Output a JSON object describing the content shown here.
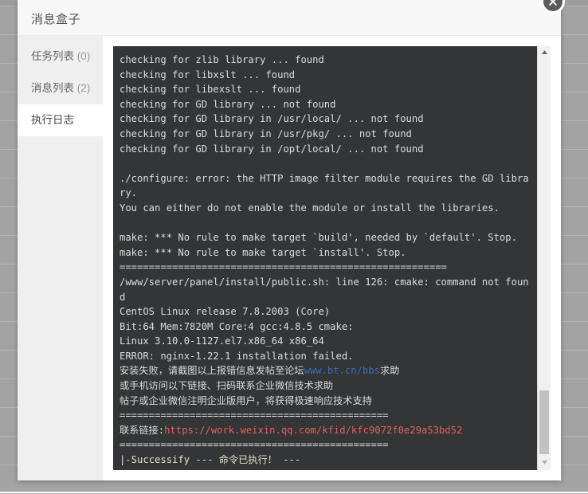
{
  "backdrop": {
    "row_count": 17,
    "color": "#a3a3a3"
  },
  "dialog": {
    "title": "消息盒子",
    "close_label": "×"
  },
  "sidebar": {
    "items": [
      {
        "label": "任务列表",
        "count": "(0)",
        "active": false,
        "name": "sidebar-item-task-list"
      },
      {
        "label": "消息列表",
        "count": "(2)",
        "active": false,
        "name": "sidebar-item-message-list"
      },
      {
        "label": "执行日志",
        "count": "",
        "active": true,
        "name": "sidebar-item-execution-log"
      }
    ]
  },
  "terminal": {
    "background": "#333537",
    "foreground": "#dcdcdc",
    "link_blue": "#3b6fb5",
    "link_red": "#e2635a",
    "success_cream": "#e8e0c8",
    "lines": [
      "checking for zlib library ... found",
      "checking for libxslt ... found",
      "checking for libexslt ... found",
      "checking for GD library ... not found",
      "checking for GD library in /usr/local/ ... not found",
      "checking for GD library in /usr/pkg/ ... not found",
      "checking for GD library in /opt/local/ ... not found",
      "",
      "./configure: error: the HTTP image filter module requires the GD library.",
      "You can either do not enable the module or install the libraries.",
      "",
      "make: *** No rule to make target `build', needed by `default'. Stop.",
      "make: *** No rule to make target `install'. Stop.",
      "========================================================",
      "/www/server/panel/install/public.sh: line 126: cmake: command not found",
      "CentOS Linux release 7.8.2003 (Core)",
      "Bit:64 Mem:7820M Core:4 gcc:4.8.5 cmake:",
      "Linux 3.10.0-1127.el7.x86_64 x86_64",
      "ERROR: nginx-1.22.1 installation failed."
    ],
    "help_line_1_pre": "安装失败，请截图以上报错信息发帖至论坛",
    "help_line_1_link": "www.bt.cn/bbs",
    "help_line_1_post": "求助",
    "help_line_2": "或手机访问以下链接、扫码联系企业微信技术求助",
    "help_line_3": "帖子或企业微信注明企业版用户，将获得极速响应技术支持",
    "separator_1": "==============================================",
    "contact_label": "联系链接:",
    "contact_url": "https://work.weixin.qq.com/kfid/kfc9072f0e29a53bd52",
    "separator_2": "==============================================",
    "cursor": "|",
    "final_line": "-Successify --- 命令已执行！ ---"
  },
  "scrollbar": {
    "up_arrow": "scroll-up-arrow",
    "down_arrow": "scroll-down-arrow",
    "thumb": "scroll-thumb"
  }
}
